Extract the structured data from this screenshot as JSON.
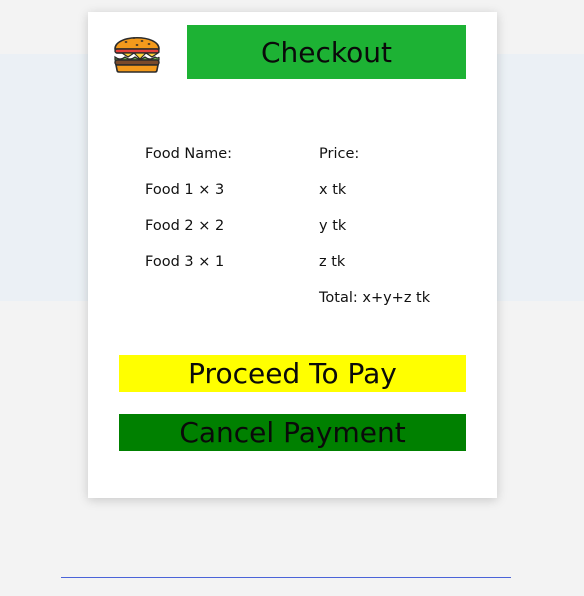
{
  "header": {
    "logo_icon": "burger-icon",
    "checkout_label": "Checkout",
    "checkout_color": "#1db234"
  },
  "order": {
    "name_header": "Food Name:",
    "price_header": "Price:",
    "items": [
      {
        "name": "Food 1 × 3",
        "price": "x tk"
      },
      {
        "name": "Food 2 × 2",
        "price": "y tk"
      },
      {
        "name": "Food 3 × 1",
        "price": "z tk"
      }
    ],
    "total": "Total: x+y+z tk"
  },
  "actions": {
    "pay_label": "Proceed To Pay",
    "pay_color": "#ffff00",
    "cancel_label": "Cancel Payment",
    "cancel_color": "#008000"
  },
  "colors": {
    "page_background": "#f3f3f3",
    "band_background": "#ebf0f5",
    "card_background": "#ffffff",
    "bottom_line": "#4a63d8"
  }
}
